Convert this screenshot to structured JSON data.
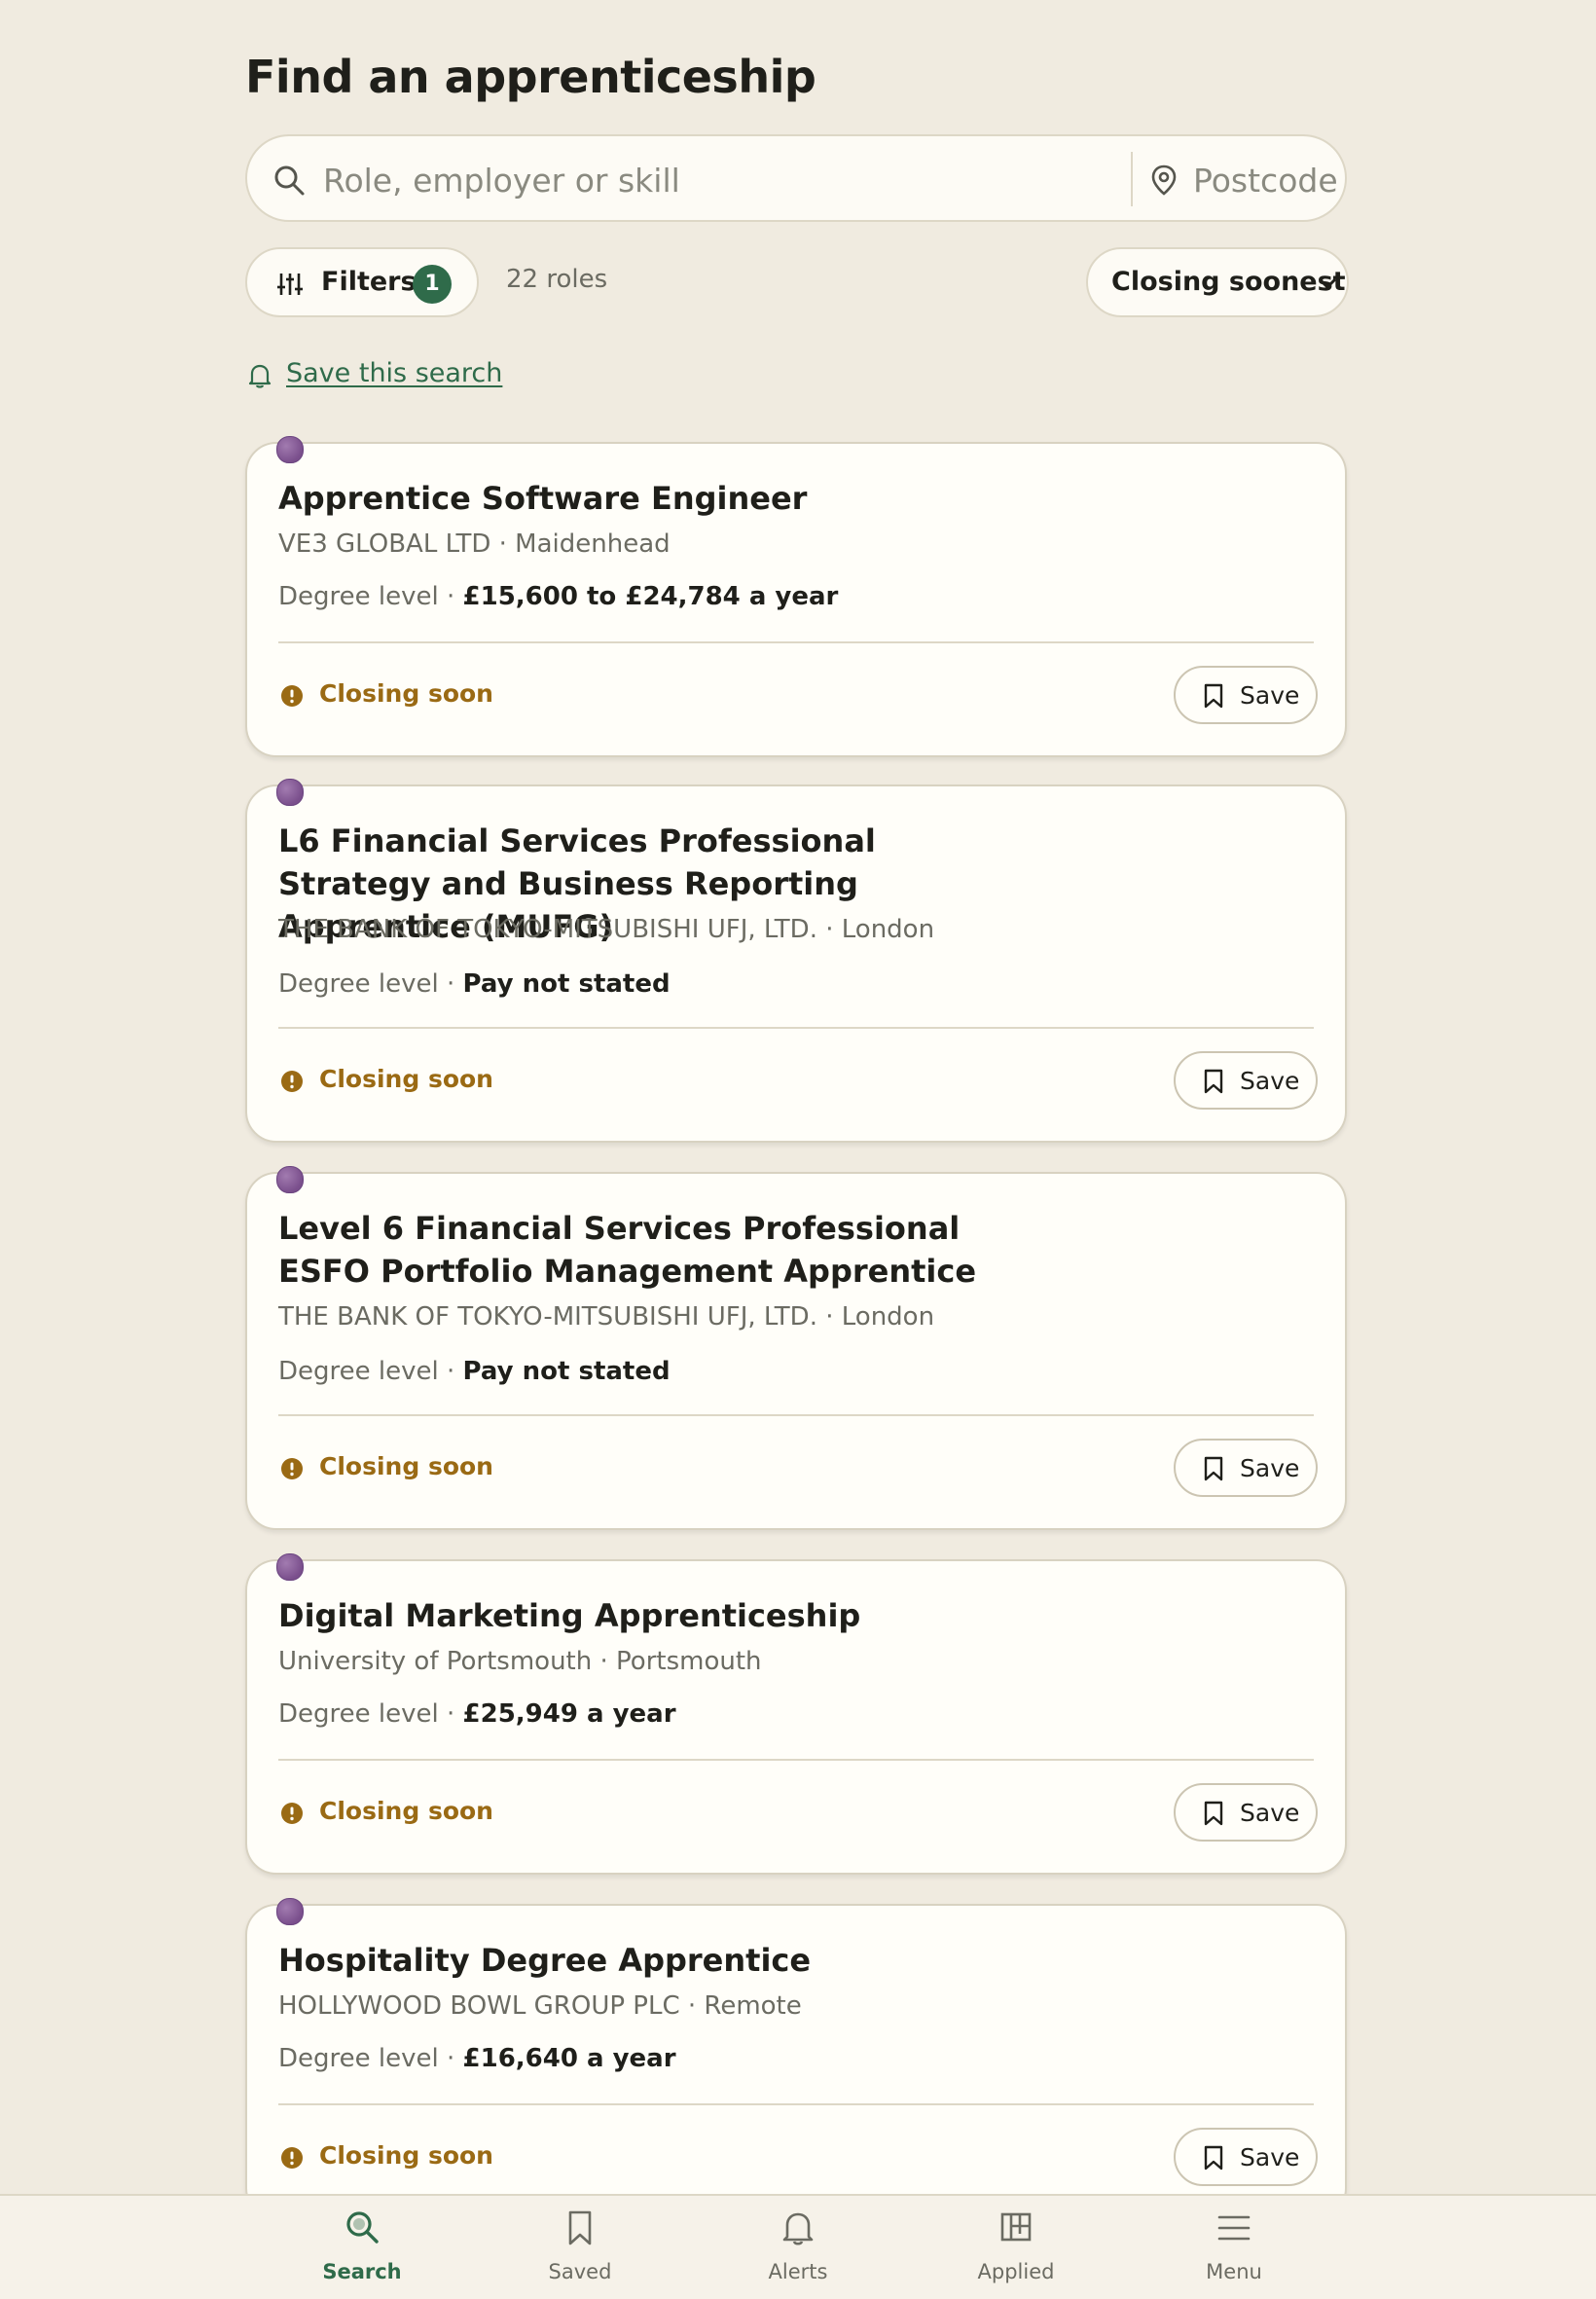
{
  "page_title": "Find an apprenticeship",
  "search": {
    "role_placeholder": "Role, employer or skill",
    "postcode_placeholder": "Postcode"
  },
  "toolbar": {
    "filters_label": "Filters",
    "filters_count": "1",
    "result_count": "22 roles",
    "sort_selected": "Closing soonest"
  },
  "save_search_label": "Save this search",
  "listings": [
    {
      "title": "Apprentice Software Engineer",
      "employer": "VE3 GLOBAL LTD",
      "location": "Maidenhead",
      "level": "Degree level",
      "pay": "£15,600 to £24,784",
      "pay_suffix": " a year",
      "status": "Closing soon",
      "save_label": "Save"
    },
    {
      "title": "L6 Financial Services Professional Strategy and Business Reporting Apprentice (MUFG)",
      "employer": "THE BANK OF TOKYO-MITSUBISHI UFJ, LTD.",
      "location": "London",
      "level": "Degree level",
      "pay": "Pay not stated",
      "pay_suffix": "",
      "status": "Closing soon",
      "save_label": "Save"
    },
    {
      "title": "Level 6 Financial Services Professional ESFO Portfolio Management Apprentice",
      "employer": "THE BANK OF TOKYO-MITSUBISHI UFJ, LTD.",
      "location": "London",
      "level": "Degree level",
      "pay": "Pay not stated",
      "pay_suffix": "",
      "status": "Closing soon",
      "save_label": "Save"
    },
    {
      "title": "Digital Marketing Apprenticeship",
      "employer": "University of Portsmouth",
      "location": "Portsmouth",
      "level": "Degree level",
      "pay": "£25,949",
      "pay_suffix": " a year",
      "status": "Closing soon",
      "save_label": "Save"
    },
    {
      "title": "Hospitality Degree Apprentice",
      "employer": "HOLLYWOOD BOWL GROUP PLC",
      "location": "Remote",
      "level": "Degree level",
      "pay": "£16,640",
      "pay_suffix": " a year",
      "status": "Closing soon",
      "save_label": "Save"
    }
  ],
  "meta_separator": " · ",
  "bottom_nav": [
    {
      "label": "Search",
      "icon": "search-icon",
      "active": true
    },
    {
      "label": "Saved",
      "icon": "bookmark-icon",
      "active": false
    },
    {
      "label": "Alerts",
      "icon": "bell-icon",
      "active": false
    },
    {
      "label": "Applied",
      "icon": "board-icon",
      "active": false
    },
    {
      "label": "Menu",
      "icon": "menu-icon",
      "active": false
    }
  ],
  "colors": {
    "background": "#f0ebe0",
    "card": "#fffef9",
    "accent_green": "#2f6b4a",
    "closing_amber": "#9a6a14",
    "marker_purple": "#7a4f8c"
  }
}
